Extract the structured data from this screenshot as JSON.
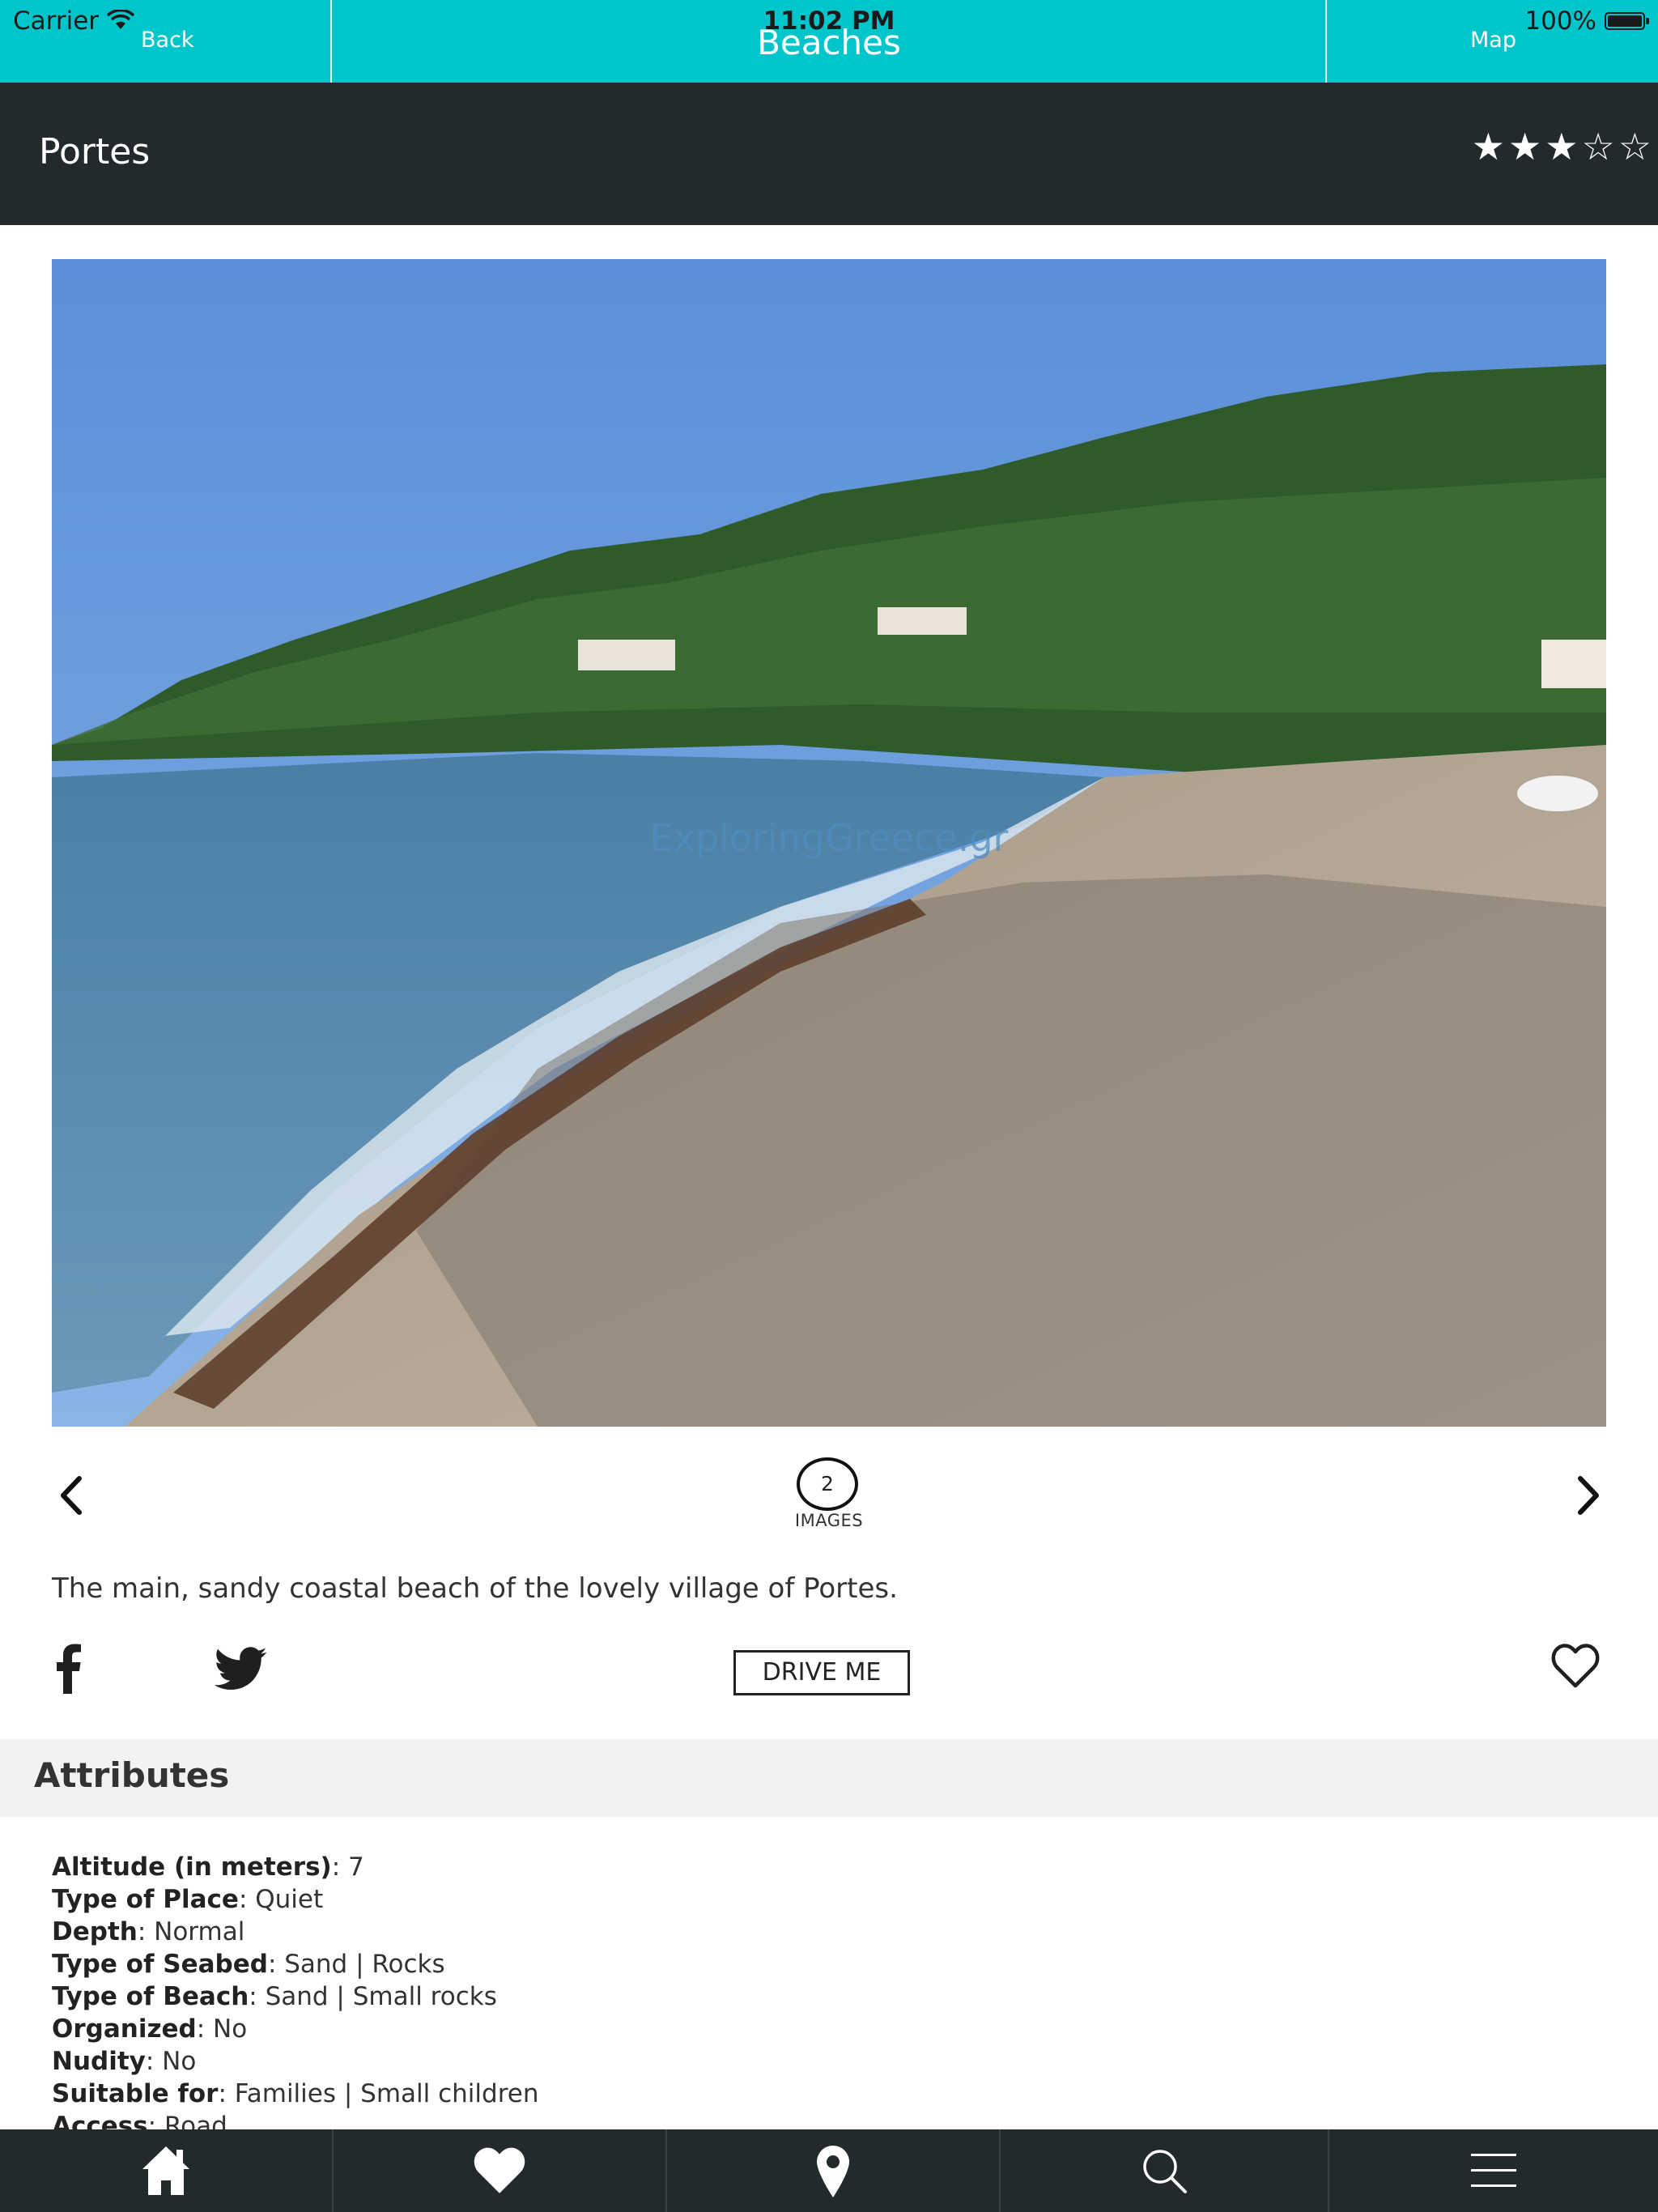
{
  "status_bar": {
    "carrier": "Carrier",
    "time": "11:02 PM",
    "battery": "100%"
  },
  "nav": {
    "back_label": "Back",
    "title": "Beaches",
    "map_label": "Map"
  },
  "place": {
    "name": "Portes",
    "rating": 3,
    "rating_max": 5
  },
  "gallery": {
    "watermark": "ExploringGreece.gr",
    "image_count": "2",
    "image_count_label": "IMAGES"
  },
  "description": "The main, sandy coastal beach of the lovely village of Portes.",
  "actions": {
    "drive_label": "DRIVE ME"
  },
  "attributes": {
    "title": "Attributes",
    "items": [
      {
        "label": "Altitude (in meters)",
        "value": ": 7"
      },
      {
        "label": "Type of Place",
        "value": ": Quiet"
      },
      {
        "label": "Depth",
        "value": ": Normal"
      },
      {
        "label": "Type of Seabed",
        "value": ": Sand | Rocks"
      },
      {
        "label": "Type of Beach",
        "value": ": Sand | Small rocks"
      },
      {
        "label": "Organized",
        "value": ": No"
      },
      {
        "label": "Nudity",
        "value": ": No"
      },
      {
        "label": "Suitable for",
        "value": ": Families | Small children"
      },
      {
        "label": "Access",
        "value": ": Road"
      }
    ]
  },
  "tabbar": {
    "items": [
      "home-icon",
      "heart-icon",
      "map-pin-icon",
      "search-icon",
      "menu-icon"
    ]
  },
  "colors": {
    "accent": "#00c6cc",
    "dark": "#232a2c",
    "section_bg": "#f2f2f2"
  }
}
